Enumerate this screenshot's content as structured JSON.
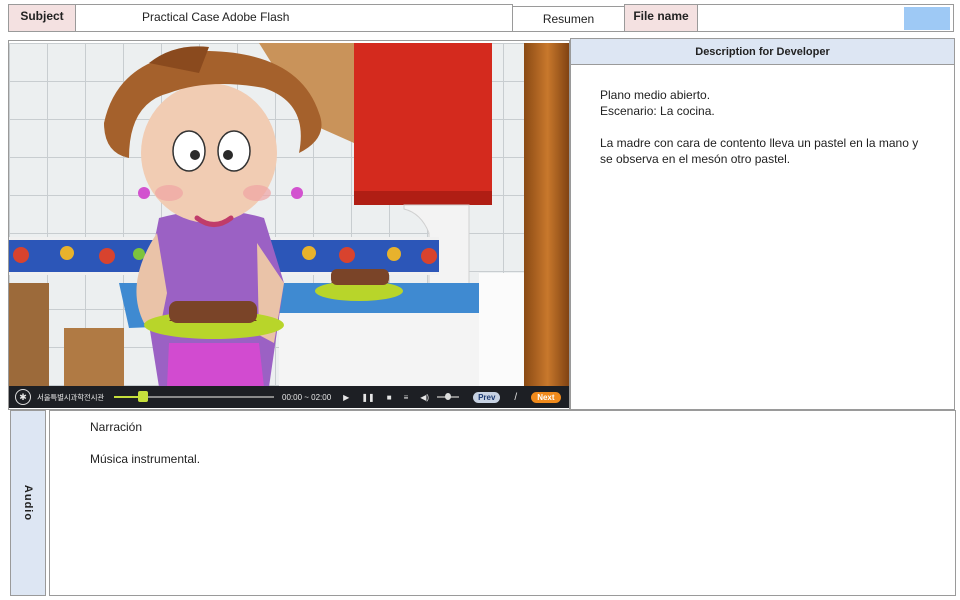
{
  "header": {
    "subject_label": "Subject",
    "subject_value": "Practical Case Adobe Flash",
    "resumen": "Resumen",
    "file_label": "File name",
    "file_value": "",
    "swatch_color": "#9ec9f5"
  },
  "player": {
    "org_text": "서울특별시과학전시관",
    "time_text": "00:00 ~ 02:00",
    "progress": 0.18,
    "volume": 0.5,
    "prev_label": "Prev",
    "separator": "/",
    "next_label": "Next",
    "icons": [
      "play-icon",
      "pause-icon",
      "stop-icon",
      "menu-icon",
      "volume-icon"
    ]
  },
  "description": {
    "title": "Description for Developer",
    "line1": "Plano medio abierto.",
    "line2": "Escenario: La cocina.",
    "line3": "La madre con cara de contento lleva un pastel en la mano y se observa en el mesón otro pastel."
  },
  "audio": {
    "label": "Audio",
    "line1": "Narración",
    "line2": "Música instrumental."
  },
  "colors": {
    "label_pink": "#f4e1e1",
    "panel_blue": "#dde6f3",
    "next_orange": "#f08a1c",
    "track_green": "#c6df3c"
  }
}
